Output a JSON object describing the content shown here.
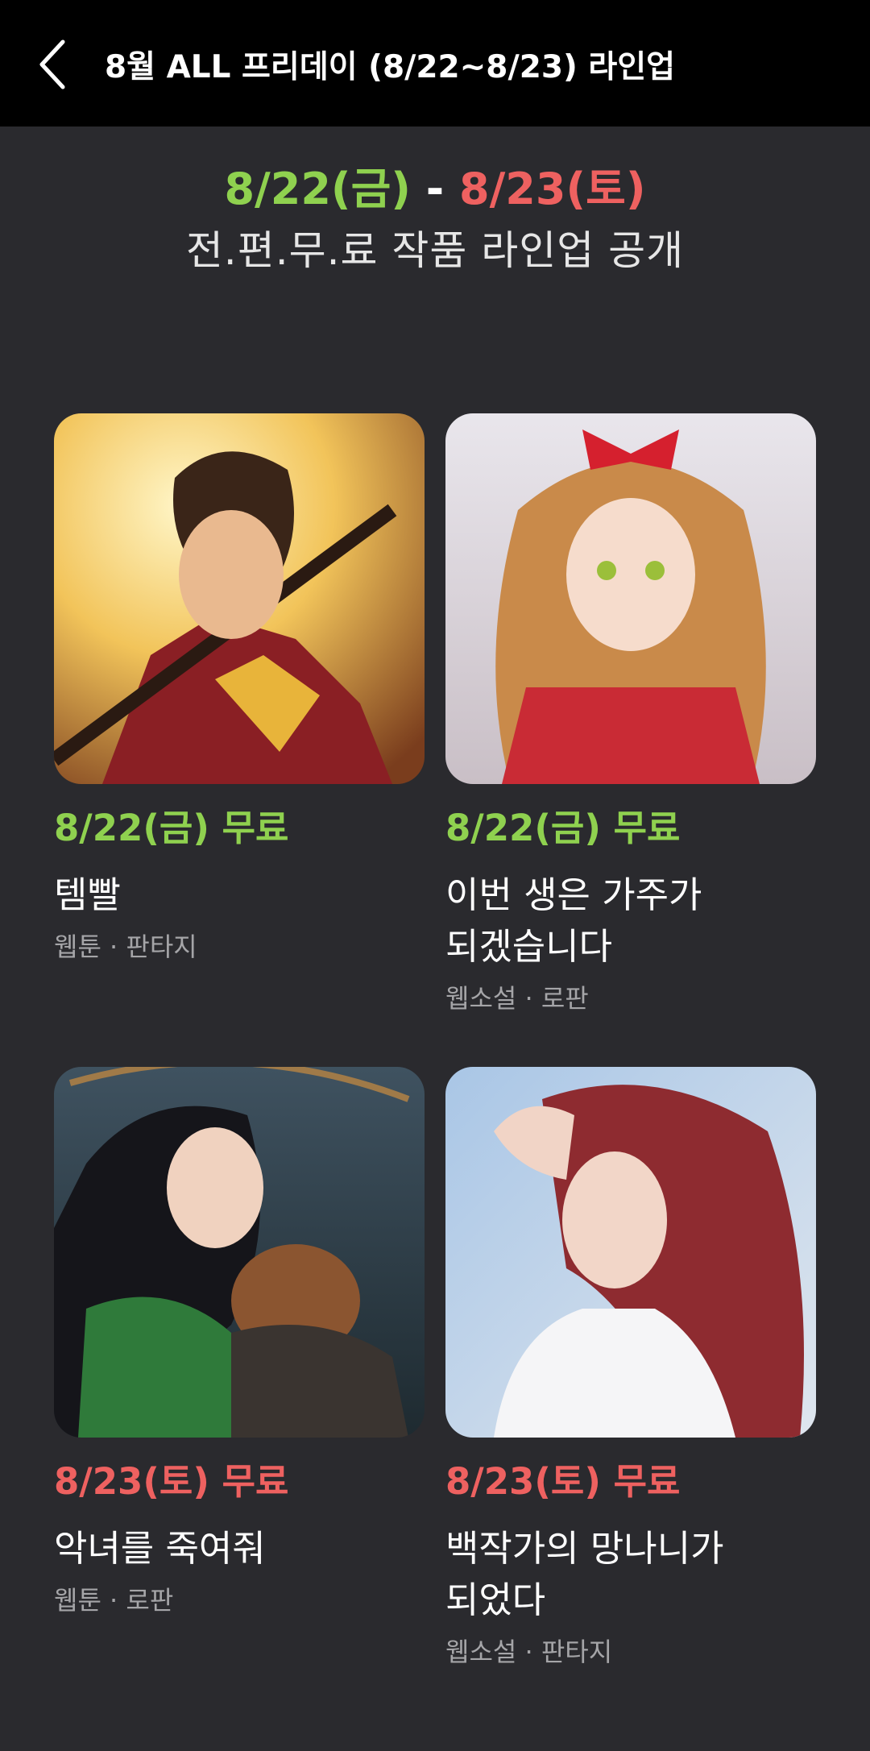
{
  "header": {
    "title": "8월 ALL 프리데이 (8/22~8/23) 라인업"
  },
  "hero": {
    "date_start": "8/22(금)",
    "separator": "-",
    "date_end": "8/23(토)",
    "subtitle": "전.편.무.료 작품 라인업 공개"
  },
  "colors": {
    "green": "#8fd14f",
    "red": "#ee6160",
    "background": "#2a2a2e"
  },
  "cards": [
    {
      "badge": "8/22(금) 무료",
      "title_lines": [
        "템빨",
        ""
      ],
      "meta": "웹툰 · 판타지"
    },
    {
      "badge": "8/22(금) 무료",
      "title_lines": [
        "이번 생은 가주가",
        "되겠습니다"
      ],
      "meta": "웹소설 · 로판"
    },
    {
      "badge": "8/23(토) 무료",
      "title_lines": [
        "악녀를 죽여줘",
        ""
      ],
      "meta": "웹툰 · 로판"
    },
    {
      "badge": "8/23(토) 무료",
      "title_lines": [
        "백작가의 망나니가",
        "되었다"
      ],
      "meta": "웹소설 · 판타지"
    }
  ]
}
